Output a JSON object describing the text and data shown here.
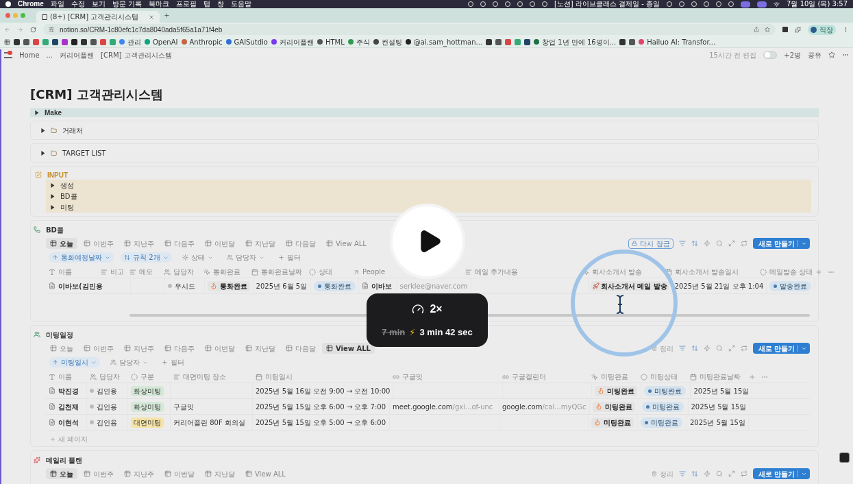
{
  "menubar": {
    "app": "Chrome",
    "menus": [
      "파일",
      "수정",
      "보기",
      "방문 기록",
      "북마크",
      "프로필",
      "탭",
      "창",
      "도움말"
    ],
    "now_playing": "[노션] 라이브클래스 결제일 - 종일",
    "clock": "7월 10일 (목) 3:57"
  },
  "browser": {
    "tab": {
      "title": "(8+) [CRM] 고객관리시스템",
      "selected": true
    },
    "url": "notion.so/CRM-1c80efc1c7da8040ada5f65a1a71f4eb",
    "profile": "직장",
    "bookmarks": [
      "관리",
      "OpenAI",
      "Anthropic",
      "GAISutdio",
      "커리어플랜",
      "HTML",
      "주식",
      "컨설팅",
      "@ai.sam_hottman...",
      "창업 1년 만에 16명이...",
      "Hailuo AI: Transfor..."
    ]
  },
  "topbar": {
    "breadcrumbs": [
      "Home",
      "...",
      "커리어플랜",
      "[CRM] 고객관리시스템"
    ],
    "edited": "15시간 전 편집",
    "lock_on": false,
    "members": "+2명",
    "share": "공유"
  },
  "page": {
    "title": "[CRM] 고객관리시스템",
    "make": {
      "label": "Make",
      "expanded": false
    },
    "toggles": [
      {
        "label": "거래처",
        "expanded": false
      },
      {
        "label": "TARGET LIST",
        "expanded": false
      }
    ],
    "input": {
      "title": "INPUT",
      "items": [
        {
          "label": "생성",
          "expanded": false
        },
        {
          "label": "BD콜",
          "expanded": false
        },
        {
          "label": "미팅",
          "expanded": false
        }
      ]
    },
    "bd_call": {
      "title": "BD콜",
      "views": [
        {
          "label": "오늘",
          "selected": true
        },
        {
          "label": "이번주",
          "selected": false
        },
        {
          "label": "지난주",
          "selected": false
        },
        {
          "label": "다음주",
          "selected": false
        },
        {
          "label": "이번달",
          "selected": false
        },
        {
          "label": "지난달",
          "selected": false
        },
        {
          "label": "다음달",
          "selected": false
        },
        {
          "label": "View ALL",
          "selected": false
        }
      ],
      "lock": "다시 잠금",
      "new_button": "새로 만들기",
      "filters": [
        {
          "label": "통화예정날짜",
          "kind": "sort",
          "active": true
        },
        {
          "label": "규칙 2개",
          "kind": "rules",
          "active": true
        },
        {
          "label": "상태",
          "kind": "status",
          "active": false
        },
        {
          "label": "담당자",
          "kind": "people",
          "active": false
        },
        {
          "label": "필터",
          "kind": "add",
          "active": false
        }
      ],
      "columns": [
        {
          "label": "이름",
          "kind": "title"
        },
        {
          "label": "비고",
          "kind": "text"
        },
        {
          "label": "메모",
          "kind": "longtext"
        },
        {
          "label": "담당자",
          "kind": "people"
        },
        {
          "label": "통화완료",
          "kind": "button"
        },
        {
          "label": "통화완료날짜",
          "kind": "date"
        },
        {
          "label": "상태",
          "kind": "status"
        },
        {
          "label": "People",
          "kind": "relation"
        },
        {
          "kind": "formula"
        },
        {
          "label": "메일 추가내용",
          "kind": "longtext"
        },
        {
          "label": "회사소개서 발송",
          "kind": "button"
        },
        {
          "label": "회사소개서 발송일시",
          "kind": "date"
        },
        {
          "label": "메일발송 상태",
          "kind": "status"
        }
      ],
      "rows": [
        {
          "cells": [
            {
              "kind": "page",
              "text": "이바보(김민용"
            },
            {
              "kind": "blank"
            },
            {
              "kind": "blank"
            },
            {
              "kind": "person",
              "text": "우시드"
            },
            {
              "kind": "flame",
              "text": "통화완료"
            },
            {
              "kind": "date",
              "text": "2025년 6월 5일"
            },
            {
              "kind": "status",
              "text": "통화완료"
            },
            {
              "kind": "page",
              "text": "이바보"
            },
            {
              "kind": "muted",
              "text": "serklee@naver.com"
            },
            {
              "kind": "blank"
            },
            {
              "kind": "rocket",
              "text": "회사소개서 메일 발송"
            },
            {
              "kind": "date",
              "text": "2025년 5월 21일 오후 1:04"
            },
            {
              "kind": "status",
              "text": "발송완료"
            }
          ]
        }
      ]
    },
    "meetings": {
      "title": "미팅일정",
      "views": [
        {
          "label": "오늘",
          "selected": false
        },
        {
          "label": "이번주",
          "selected": false
        },
        {
          "label": "지난주",
          "selected": false
        },
        {
          "label": "다음주",
          "selected": false
        },
        {
          "label": "이번달",
          "selected": false
        },
        {
          "label": "지난달",
          "selected": false
        },
        {
          "label": "다음달",
          "selected": false
        },
        {
          "label": "View ALL",
          "selected": true
        }
      ],
      "arrange": "정리",
      "new_button": "새로 만들기",
      "filters": [
        {
          "label": "미팅일시",
          "kind": "sort",
          "active": true
        },
        {
          "label": "담당자",
          "kind": "people",
          "active": false
        },
        {
          "label": "필터",
          "kind": "add",
          "active": false
        }
      ],
      "columns": [
        {
          "label": "이름",
          "kind": "title"
        },
        {
          "label": "담당자",
          "kind": "people"
        },
        {
          "label": "구분",
          "kind": "select"
        },
        {
          "label": "대면미팅 장소",
          "kind": "longtext"
        },
        {
          "label": "미팅일시",
          "kind": "date"
        },
        {
          "label": "구글밋",
          "kind": "url"
        },
        {
          "label": "구글캘린더",
          "kind": "url"
        },
        {
          "label": "미팅완료",
          "kind": "button"
        },
        {
          "label": "미팅상태",
          "kind": "status"
        },
        {
          "label": "미팅완료날짜",
          "kind": "date"
        }
      ],
      "rows": [
        {
          "cells": [
            {
              "kind": "page",
              "text": "박진경"
            },
            {
              "kind": "person",
              "text": "김인용"
            },
            {
              "kind": "tag",
              "text": "화상미팅",
              "color": "#d5e8d8"
            },
            {
              "kind": "blank"
            },
            {
              "kind": "date",
              "text": "2025년 5월 16일 오전 9:00 → 오전 10:00"
            },
            {
              "kind": "blank"
            },
            {
              "kind": "blank"
            },
            {
              "kind": "flame",
              "text": "미팅완료"
            },
            {
              "kind": "status",
              "text": "미팅완료"
            },
            {
              "kind": "date",
              "text": "2025년 5월 15일"
            }
          ]
        },
        {
          "cells": [
            {
              "kind": "page",
              "text": "김천재"
            },
            {
              "kind": "person",
              "text": "김인용"
            },
            {
              "kind": "tag",
              "text": "화상미팅",
              "color": "#d5e8d8"
            },
            {
              "kind": "date",
              "text": "구글밋"
            },
            {
              "kind": "date",
              "text": "2025년 5월 15일 오후 6:00 → 오후 7:00"
            },
            {
              "kind": "link",
              "text": "meet.google.com",
              "rest": "/gxi...of-unc"
            },
            {
              "kind": "link",
              "text": "google.com",
              "rest": "/cal...myQGc"
            },
            {
              "kind": "flame",
              "text": "미팅완료"
            },
            {
              "kind": "status",
              "text": "미팅완료"
            },
            {
              "kind": "date",
              "text": "2025년 5월 15일"
            }
          ]
        },
        {
          "cells": [
            {
              "kind": "page",
              "text": "이현석"
            },
            {
              "kind": "person",
              "text": "김인용"
            },
            {
              "kind": "tag",
              "text": "대면미팅",
              "color": "#f5e3a8"
            },
            {
              "kind": "date",
              "text": "커리어플린 80F 회의실"
            },
            {
              "kind": "date",
              "text": "2025년 5월 15일 오후 5:00 → 오후 6:00"
            },
            {
              "kind": "blank"
            },
            {
              "kind": "blank"
            },
            {
              "kind": "flame",
              "text": "미팅완료"
            },
            {
              "kind": "status",
              "text": "미팅완료"
            },
            {
              "kind": "date",
              "text": "2025년 5월 15일"
            }
          ]
        }
      ],
      "new_page": "새 페이지"
    },
    "daily": {
      "title": "데일리 플랜",
      "views": [
        {
          "label": "오늘",
          "selected": true
        },
        {
          "label": "이번주",
          "selected": false
        },
        {
          "label": "지난주",
          "selected": false
        },
        {
          "label": "이번달",
          "selected": false
        },
        {
          "label": "지난달",
          "selected": false
        },
        {
          "label": "View ALL",
          "selected": false
        }
      ],
      "arrange": "정리",
      "new_button": "새로 만들기"
    }
  },
  "player": {
    "speed": "2×",
    "original": "7 min",
    "bolt": "⚡",
    "duration": "3 min 42 sec"
  }
}
